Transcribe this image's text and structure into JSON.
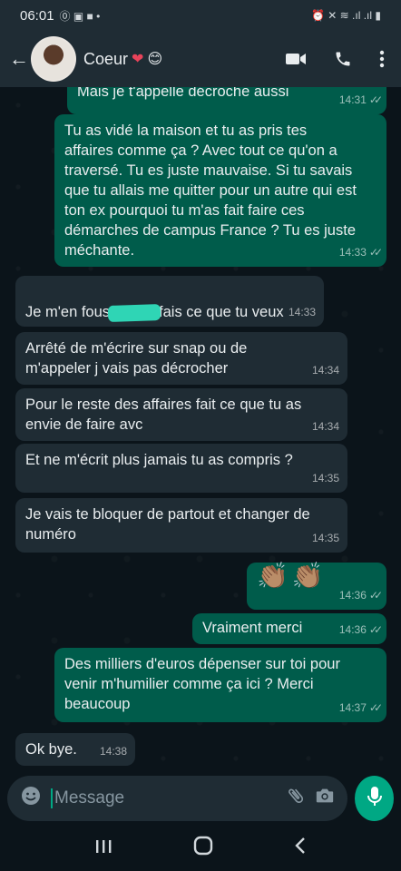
{
  "status": {
    "time": "06:01",
    "left_glyphs": "⓪ ▣ ■ •",
    "right_glyphs": "⏰ ✕ ≋ .ıl .ıl ▮"
  },
  "header": {
    "contact_name": "Coeur",
    "heart": "❤",
    "emoji": "😊"
  },
  "messages": [
    {
      "dir": "out",
      "text": "Mais je t'appelle décroche aussi",
      "time": "14:31",
      "ticks": "✓✓"
    },
    {
      "dir": "out",
      "text": "Tu as vidé la maison et tu as pris tes affaires comme ça ? Avec tout ce qu'on a traversé. Tu es juste mauvaise. Si tu savais que tu allais me quitter pour un autre qui est ton ex pourquoi tu m'as fait faire ces démarches de campus France ? Tu es juste méchante.",
      "time": "14:33",
      "ticks": "✓✓"
    },
    {
      "dir": "in",
      "text_before": "Je m'en fous",
      "text_after": "fais ce que tu veux",
      "time": "14:33"
    },
    {
      "dir": "in",
      "text": "Arrêté de m'écrire sur snap ou de m'appeler j vais pas décrocher",
      "time": "14:34"
    },
    {
      "dir": "in",
      "text": "Pour le reste des affaires fait ce que tu as envie de faire avc",
      "time": "14:34"
    },
    {
      "dir": "in",
      "text": "Et ne m'écrit plus jamais tu as compris ?",
      "time": "14:35"
    },
    {
      "dir": "in",
      "text": "Je vais te bloquer de partout et changer de numéro",
      "time": "14:35"
    },
    {
      "dir": "out",
      "text": "👏🏽👏🏽",
      "time": "14:36",
      "ticks": "✓✓"
    },
    {
      "dir": "out",
      "text": "Vraiment merci",
      "time": "14:36",
      "ticks": "✓✓"
    },
    {
      "dir": "out",
      "text": "Des milliers d'euros dépenser sur toi pour venir m'humilier comme ça ici ? Merci beaucoup",
      "time": "14:37",
      "ticks": "✓✓"
    },
    {
      "dir": "in",
      "text": "Ok bye.",
      "time": "14:38"
    }
  ],
  "input": {
    "placeholder": "Message"
  },
  "colors": {
    "outgoing_bubble": "#005c4b",
    "incoming_bubble": "#1f2c34",
    "accent": "#00a884",
    "background": "#0b141a"
  }
}
